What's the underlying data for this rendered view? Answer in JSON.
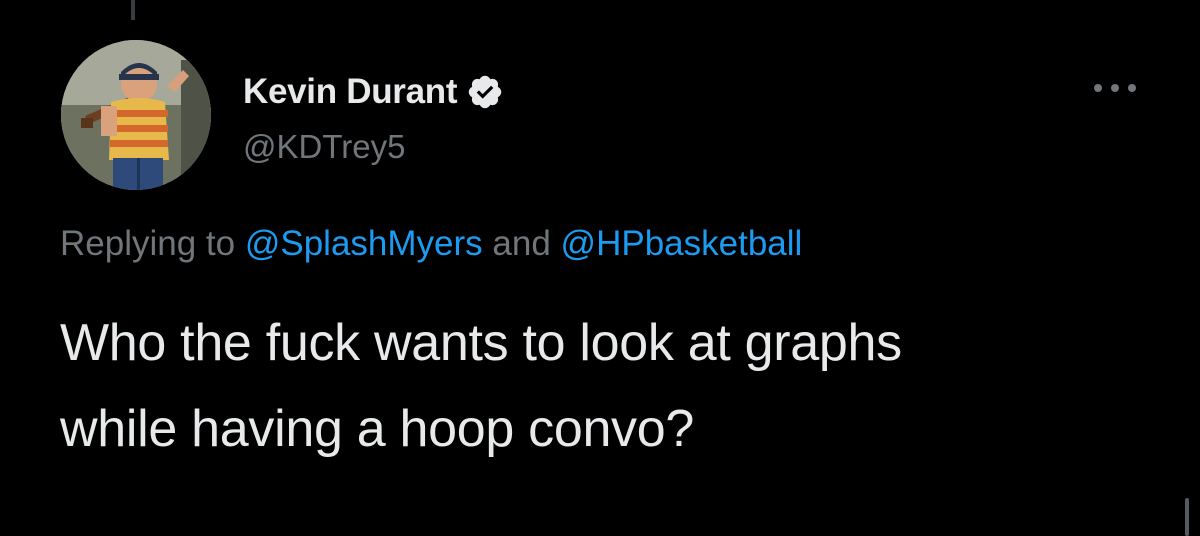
{
  "author": {
    "display_name": "Kevin Durant",
    "handle": "@KDTrey5",
    "verified": true,
    "avatar_icon": "profile-photo-boy-with-baseball-bat"
  },
  "actions": {
    "more_icon": "ellipsis-icon"
  },
  "reply_context": {
    "prefix": "Replying to",
    "mention_1": "@SplashMyers",
    "joiner": "and",
    "mention_2": "@HPbasketball"
  },
  "tweet": {
    "line_1": "Who the fuck wants to look at graphs",
    "line_2": "while having a hoop convo?"
  },
  "colors": {
    "background": "#000000",
    "primary_text": "#e7e9ea",
    "secondary_text": "#71767b",
    "link": "#1d9bf0",
    "badge": "#e7e9ea"
  }
}
